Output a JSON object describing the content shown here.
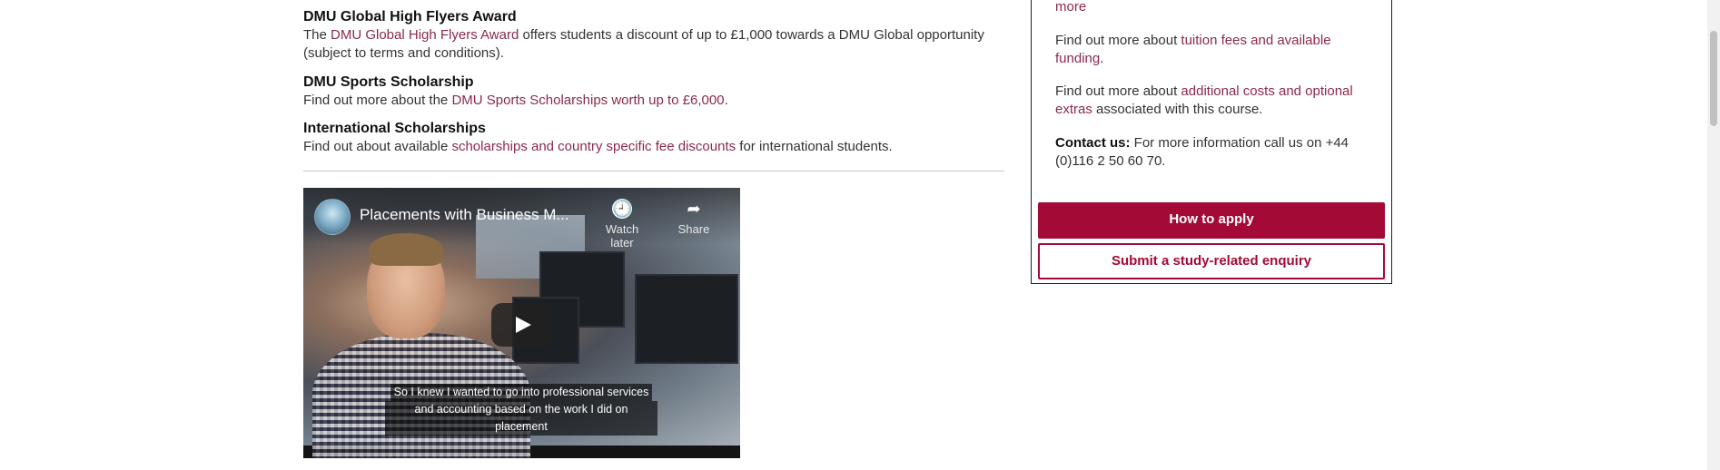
{
  "scholarships": [
    {
      "title": "DMU Global High Flyers Award",
      "pre": "The ",
      "link": "DMU Global High Flyers Award",
      "post": " offers students a discount of up to £1,000 towards a DMU Global opportunity (subject to terms and conditions)."
    },
    {
      "title": "DMU Sports Scholarship",
      "pre": "Find out more about the ",
      "link": "DMU Sports Scholarships worth up to £6,000",
      "post": "."
    },
    {
      "title": "International Scholarships",
      "pre": "Find out about available ",
      "link": "scholarships and country specific fee discounts",
      "post": " for international students."
    }
  ],
  "video": {
    "title": "Placements with Business M...",
    "watch_later": "Watch later",
    "share": "Share",
    "caption_line1": "So I knew I wanted to go into professional services",
    "caption_line2": "and accounting based on the work I did on placement"
  },
  "sidebar": {
    "more_link": "more",
    "fees_pre": "Find out more about ",
    "fees_link": "tuition fees and available funding",
    "fees_post": ".",
    "costs_pre": "Find out more about ",
    "costs_link": "additional costs and optional extras",
    "costs_post": " associated with this course.",
    "contact_label": "Contact us:",
    "contact_text": " For more information call us on +44 (0)116 2 50 60 70.",
    "apply_button": "How to apply",
    "enquiry_button": "Submit a study-related enquiry"
  },
  "colors": {
    "link": "#8a2a4b",
    "primary_button": "#a30a35"
  }
}
